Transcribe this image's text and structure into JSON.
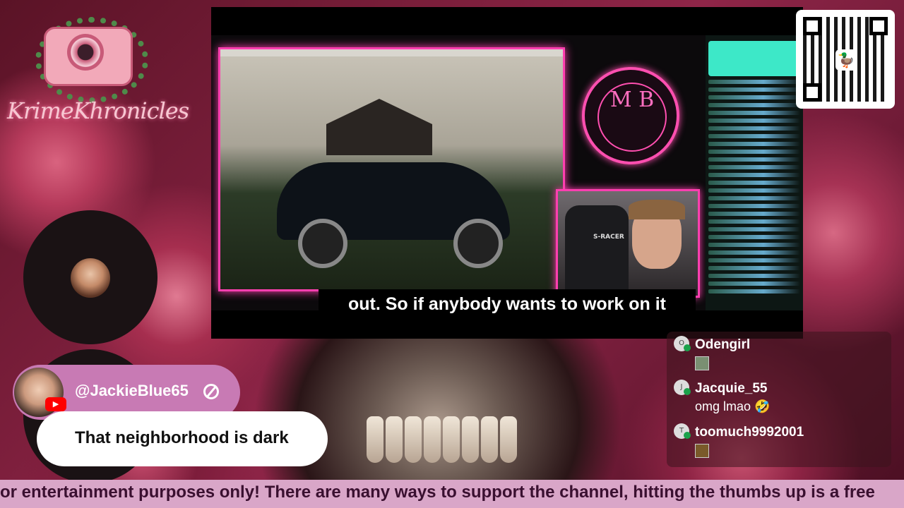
{
  "channel": {
    "logo_text": "KrimeKhronicles"
  },
  "video": {
    "caption": "out. So if anybody wants to work on it",
    "webcam_chair_text": "S-RACER",
    "logo_circle_text": "M B"
  },
  "chat_feed": {
    "items": [
      {
        "avatar": "O",
        "username": "Odengirl",
        "message": ""
      },
      {
        "avatar": "J",
        "username": "Jacquie_55",
        "message": "omg lmao 🤣"
      },
      {
        "avatar": "T",
        "username": "toomuch9992001",
        "message": ""
      }
    ]
  },
  "highlight": {
    "handle": "@JackieBlue65",
    "platform_badge": "▶",
    "message": "That neighborhood is dark"
  },
  "ticker": {
    "text": "or entertainment purposes only! There are many ways to support the channel, hitting the thumbs up is a free"
  },
  "colors": {
    "neon_pink": "#ff3fb0",
    "ticker_bg": "#d9a6c8",
    "pill_bg": "#c87ab4"
  }
}
